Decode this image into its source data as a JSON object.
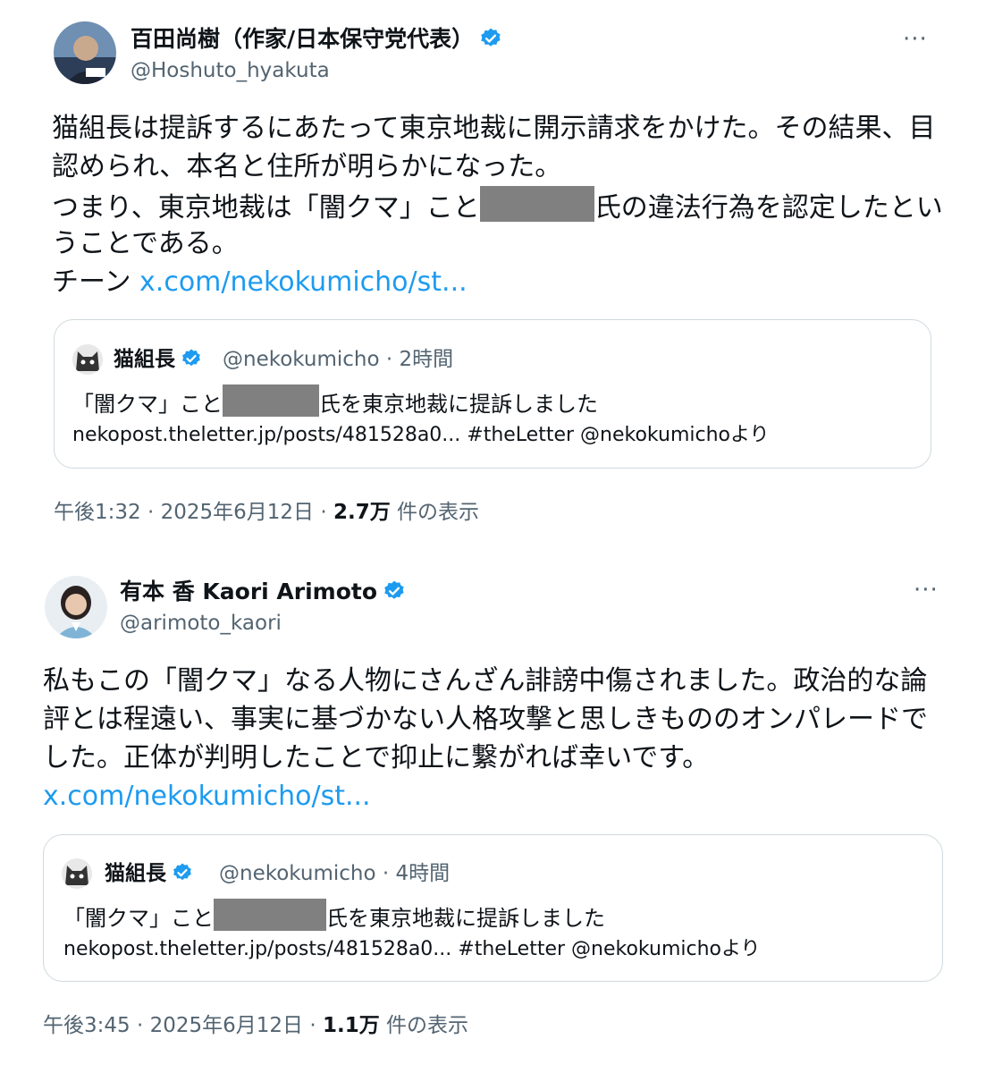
{
  "tweets": [
    {
      "author_name": "百田尚樹（作家/日本保守党代表）",
      "handle": "@Hoshuto_hyakuta",
      "avatar_icon": "man-portrait-avatar",
      "body": {
        "line1": "猫組長は提訴するにあたって東京地裁に開示請求をかけた。その結果、目",
        "line2": "認められ、本名と住所が明らかになった。",
        "line3_before": "つまり、東京地裁は「闇クマ」こと",
        "line3_after": "氏の違法行為を認定したとい",
        "line4": "うことである。",
        "line5_text": "チーン ",
        "line5_link": "x.com/nekokumicho/st..."
      },
      "quote": {
        "name": "猫組長",
        "handle": "@nekokumicho",
        "time": "2時間",
        "text_before": "「闇クマ」こと",
        "text_after": "氏を東京地裁に提訴しました",
        "link_line": "nekopost.theletter.jp/posts/481528a0... #theLetter @nekokumichoより"
      },
      "footer": {
        "time": "午後1:32",
        "date": "2025年6月12日",
        "views": "2.7万",
        "views_label": "件の表示"
      }
    },
    {
      "author_name": "有本 香 Kaori Arimoto",
      "handle": "@arimoto_kaori",
      "avatar_icon": "woman-portrait-avatar",
      "body": {
        "line1": "私もこの「闇クマ」なる人物にさんざん誹謗中傷されました。政治的な論",
        "line2": "評とは程遠い、事実に基づかない人格攻撃と思しきもののオンパレードで",
        "line3": "した。正体が判明したことで抑止に繋がれば幸いです。",
        "line4_link": "x.com/nekokumicho/st..."
      },
      "quote": {
        "name": "猫組長",
        "handle": "@nekokumicho",
        "time": "4時間",
        "text_before": "「闇クマ」こと",
        "text_after": "氏を東京地裁に提訴しました",
        "link_line": "nekopost.theletter.jp/posts/481528a0... #theLetter @nekokumichoより"
      },
      "footer": {
        "time": "午後3:45",
        "date": "2025年6月12日",
        "views": "1.1万",
        "views_label": "件の表示"
      }
    }
  ],
  "ui": {
    "more_glyph": "···",
    "separator": " · ",
    "verified_color": "#1d9bf0",
    "link_color": "#1d9bf0",
    "redaction_color": "#808080"
  }
}
